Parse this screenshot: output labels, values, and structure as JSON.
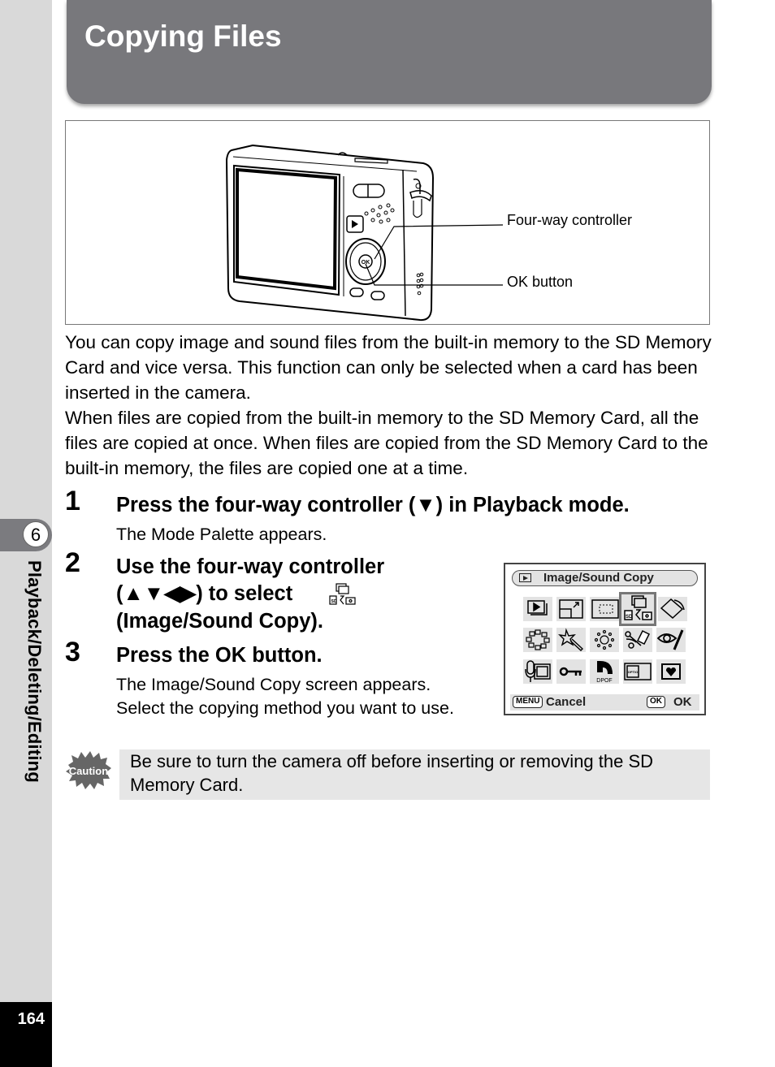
{
  "header": {
    "title": "Copying Files"
  },
  "sidebar": {
    "chapter_number": "6",
    "chapter_label": "Playback/Deleting/Editing",
    "page_number": "164"
  },
  "figure": {
    "callouts": [
      {
        "label": "Four-way controller"
      },
      {
        "label": "OK button"
      }
    ],
    "camera_button_label": "OK"
  },
  "intro": {
    "paragraphs": [
      "You can copy image and sound files from the built-in memory to the SD Memory Card and vice versa. This function can only be selected when a card has been inserted in the camera.",
      "When files are copied from the built-in memory to the SD Memory Card, all the files are copied at once. When files are copied from the SD Memory Card to the built-in memory, the files are copied one at a time."
    ]
  },
  "steps": [
    {
      "number": "1",
      "title": "Press the four-way controller (▼) in Playback mode.",
      "description": "The Mode Palette appears."
    },
    {
      "number": "2",
      "title_line1": "Use the four-way controller",
      "title_line2": "(▲▼◀▶) to select",
      "title_line3": "(Image/Sound Copy)."
    },
    {
      "number": "3",
      "title": "Press the OK button.",
      "description_line1": "The Image/Sound Copy screen appears.",
      "description_line2": "Select the copying method you want to use."
    }
  ],
  "camera_screen": {
    "title": "Image/Sound Copy",
    "mode_icon": "playback-icon",
    "icons": [
      [
        "slideshow-icon",
        "resize-icon",
        "cropping-icon",
        "image-sound-copy-icon",
        "rotate-icon"
      ],
      [
        "color-filter-icon",
        "digital-filter-icon",
        "brightness-filter-icon",
        "red-eye-icon",
        "frame-composite-icon"
      ],
      [
        "voice-memo-icon",
        "protect-icon",
        "dpof-icon",
        "startup-screen-icon",
        "favorites-icon"
      ]
    ],
    "selected_icon": "image-sound-copy-icon",
    "icon_text": {
      "dpof": "DPOF",
      "optio": "OPTIO",
      "sd": "SD"
    },
    "footer": {
      "menu_key": "MENU",
      "cancel_label": "Cancel",
      "ok_key": "OK",
      "ok_label": "OK"
    }
  },
  "caution": {
    "icon_label": "Caution",
    "text": "Be sure to turn the camera off before inserting or removing the SD Memory Card."
  }
}
